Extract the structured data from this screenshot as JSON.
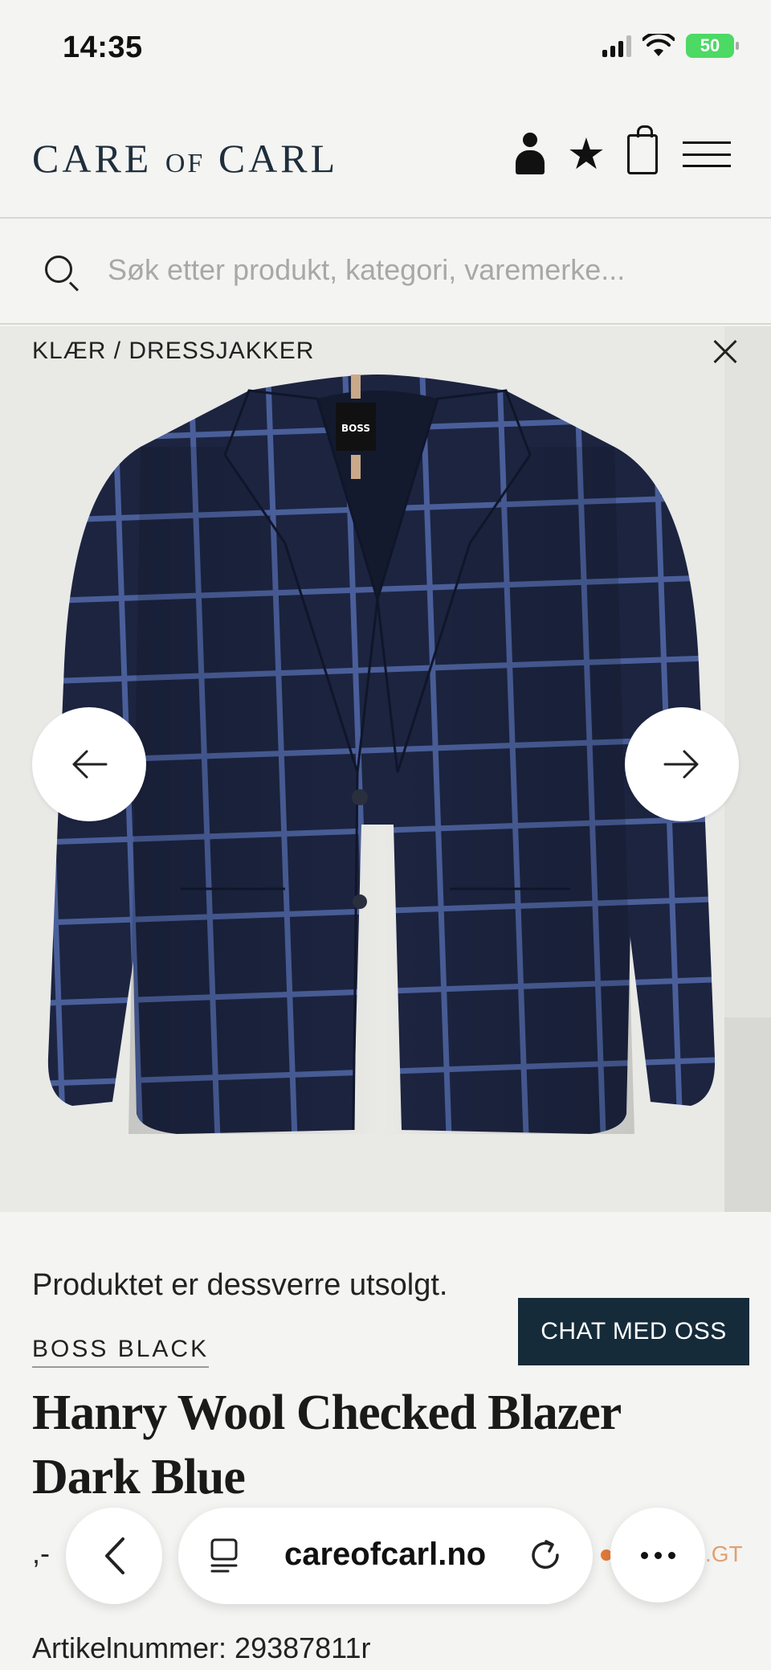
{
  "status_bar": {
    "time": "14:35",
    "battery": "50"
  },
  "header": {
    "logo_left": "CARE",
    "logo_mid": "OF",
    "logo_right": "CARL",
    "icons": [
      "user-icon",
      "star-icon",
      "bag-icon",
      "menu-icon"
    ]
  },
  "search": {
    "placeholder": "Søk etter produkt, kategori, varemerke..."
  },
  "breadcrumb": "KLÆR / DRESSJAKKER",
  "image": {
    "label": "BOSS",
    "colors": {
      "jacket": "#1c2440",
      "check": "#4a5f9a",
      "background": "#e9e9e6"
    }
  },
  "product": {
    "soldout": "Produktet er dessverre utsolgt.",
    "brand": "BOSS BLACK",
    "title": "Hanry Wool Checked Blazer Dark Blue",
    "price": ",-",
    "article_number": "Artikelnummer: 29387811r"
  },
  "chat_button": "CHAT MED OSS",
  "browser": {
    "url": "careofcarl.no",
    "peek": ".GT"
  },
  "colors": {
    "accent": "#152b3a",
    "logo": "#1e2e3c"
  }
}
